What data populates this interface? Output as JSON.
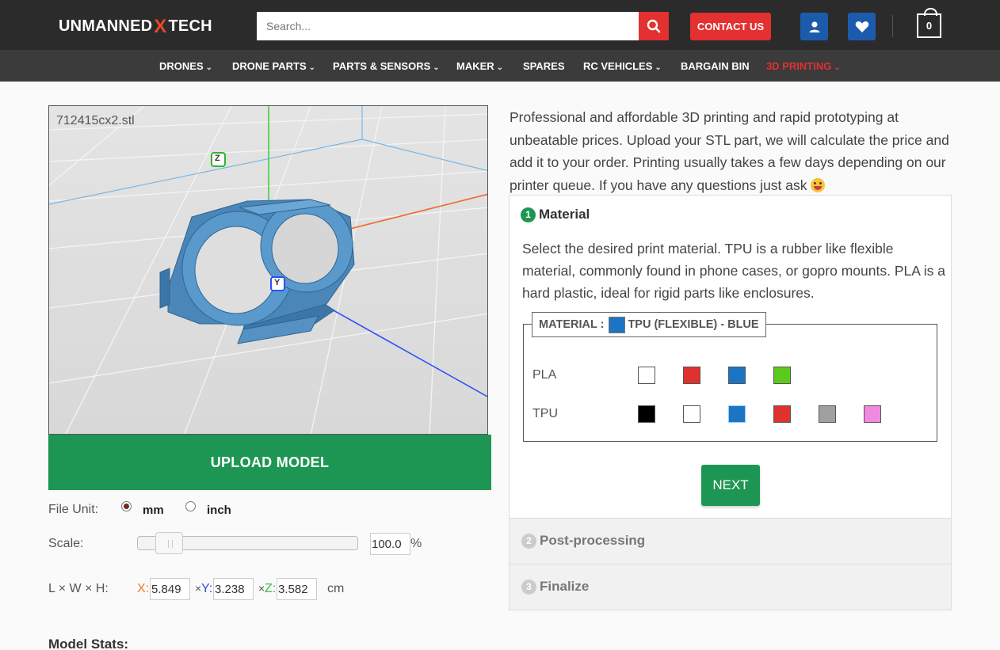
{
  "header": {
    "logo_left": "UNMANNED",
    "logo_mark": "X",
    "logo_right": "TECH",
    "search_placeholder": "Search...",
    "contact_label": "CONTACT US",
    "cart_count": "0"
  },
  "nav": [
    {
      "label": "DRONES",
      "has_menu": true
    },
    {
      "label": "DRONE PARTS",
      "has_menu": true
    },
    {
      "label": "PARTS & SENSORS",
      "has_menu": true
    },
    {
      "label": "MAKER",
      "has_menu": true
    },
    {
      "label": "SPARES",
      "has_menu": false
    },
    {
      "label": "RC VEHICLES",
      "has_menu": true
    },
    {
      "label": "BARGAIN BIN",
      "has_menu": false
    },
    {
      "label": "3D PRINTING",
      "has_menu": true,
      "active": true
    }
  ],
  "viewer": {
    "filename": "712415cx2.stl",
    "axis_z": "Z",
    "axis_y": "Y",
    "upload_label": "UPLOAD MODEL"
  },
  "settings": {
    "file_unit_label": "File Unit:",
    "unit_mm": "mm",
    "unit_inch": "inch",
    "selected_unit": "mm",
    "scale_label": "Scale:",
    "scale_value": "100.0",
    "scale_percent": 1.0,
    "percent_sign": "%",
    "dims_label": "L × W × H:",
    "x_label": "X:",
    "y_label": "Y:",
    "z_label": "Z:",
    "x_value": "5.849",
    "y_value": "3.238",
    "z_value": "3.582",
    "sep": "×",
    "dim_unit": "cm",
    "stats_title": "Model Stats:"
  },
  "intro": "Professional and affordable 3D printing and rapid prototyping at unbeatable prices.  Upload your STL part, we will calculate the price and add it to your order.  Printing usually takes a few days depending on our printer queue.  If you have any questions just ask",
  "steps": {
    "material": {
      "num": "1",
      "title": "Material",
      "description": "Select the desired print material.  TPU is a rubber like flexible material, commonly found in phone cases, or gopro mounts.  PLA is a hard plastic, ideal for rigid parts like enclosures.",
      "legend_prefix": "MATERIAL :",
      "selected": "TPU (FLEXIBLE) - BLUE",
      "selected_color": "#1c74c3",
      "rows": [
        {
          "label": "PLA",
          "colors": [
            "#ffffff",
            "#e03131",
            "#1c74c3",
            "#5cc91c"
          ]
        },
        {
          "label": "TPU",
          "colors": [
            "#000000",
            "#ffffff",
            "#1c74c3",
            "#e03131",
            "#a0a0a0",
            "#f08ae0"
          ]
        }
      ],
      "next_label": "NEXT"
    },
    "post": {
      "num": "2",
      "title": "Post-processing"
    },
    "finalize": {
      "num": "3",
      "title": "Finalize"
    }
  },
  "colors": {
    "brand_red": "#e33030",
    "brand_blue": "#1c5bac",
    "green": "#1e9653"
  }
}
